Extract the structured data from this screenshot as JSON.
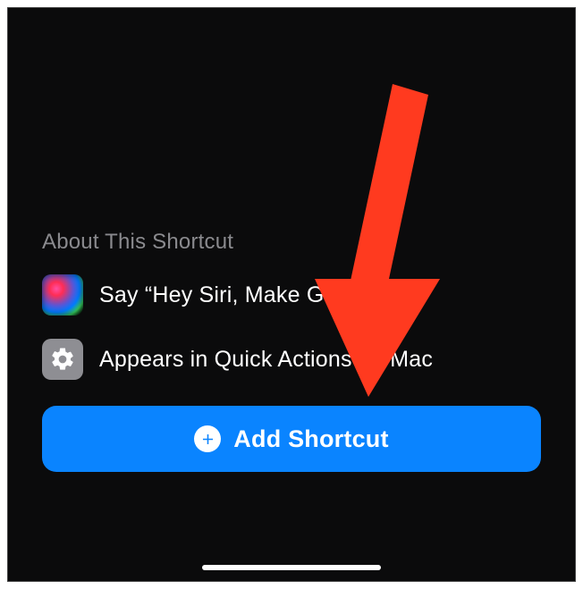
{
  "section": {
    "title": "About This Shortcut",
    "items": [
      {
        "icon_name": "siri-icon",
        "text": "Say “Hey Siri, Make GIF” to run"
      },
      {
        "icon_name": "gear-icon",
        "text": "Appears in Quick Actions on Mac"
      }
    ]
  },
  "add_button": {
    "label": "Add Shortcut"
  },
  "overlay": {
    "arrow_color": "#ff3a1f"
  }
}
